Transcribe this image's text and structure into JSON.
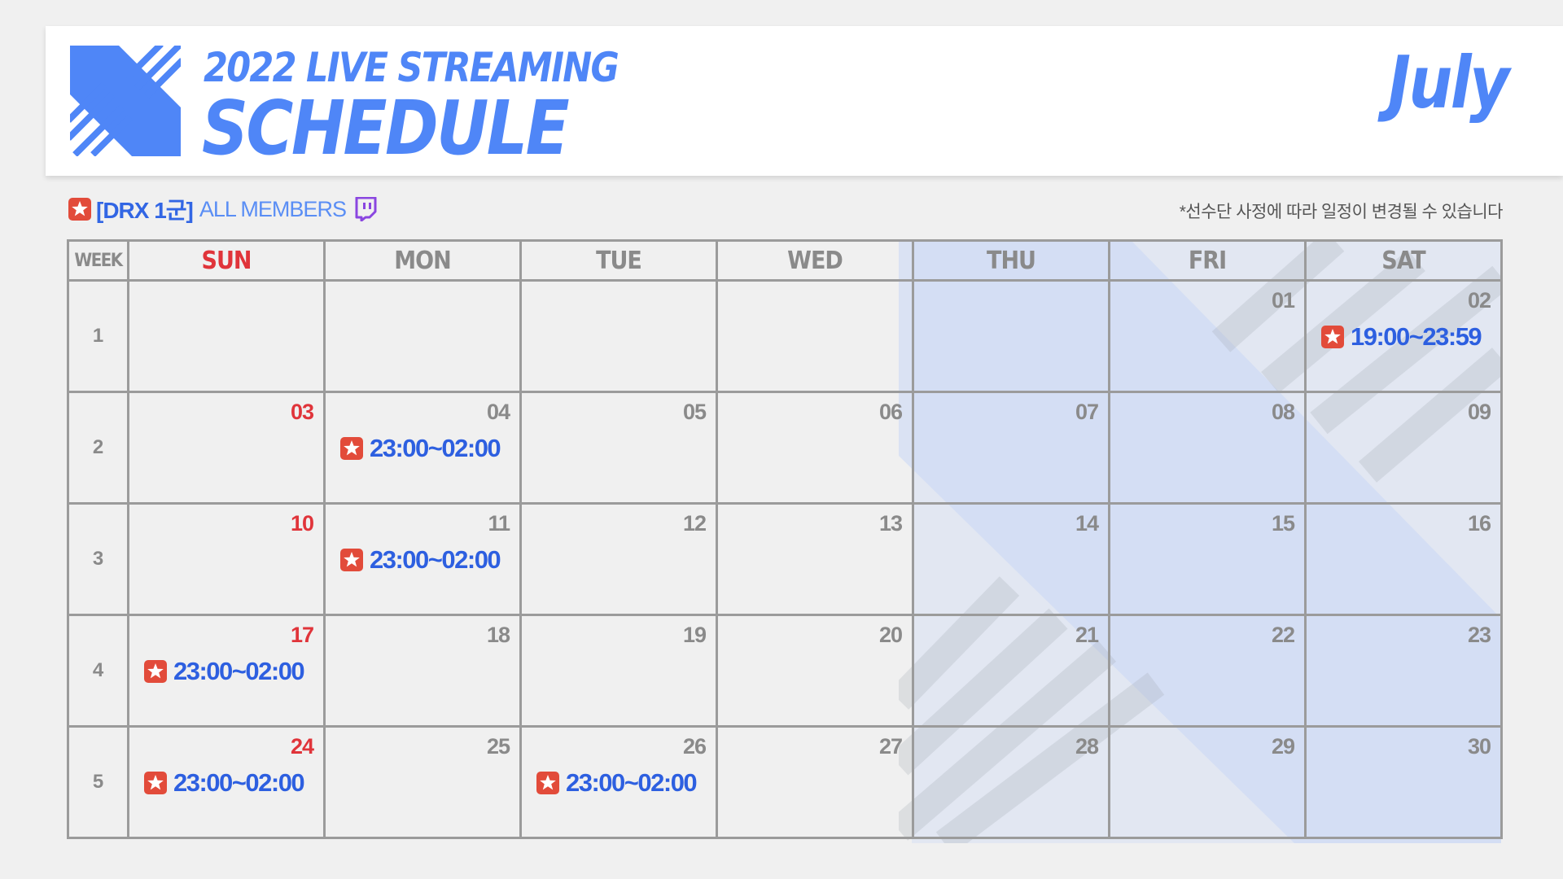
{
  "header": {
    "title_line1": "2022 LIVE STREAMING",
    "title_line2": "SCHEDULE",
    "month": "July"
  },
  "subheader": {
    "team": "[DRX 1군]",
    "members": "ALL MEMBERS",
    "notice": "*선수단 사정에 따라 일정이 변경될 수 있습니다",
    "icons": [
      "star-badge-icon",
      "twitch-icon"
    ]
  },
  "colors": {
    "brand_blue": "#4f86f7",
    "time_blue": "#2d5fe0",
    "sunday_red": "#e0343a",
    "badge_red": "#e24b3a",
    "twitch_purple": "#8a46e0"
  },
  "calendar": {
    "week_header": "WEEK",
    "days": [
      "SUN",
      "MON",
      "TUE",
      "WED",
      "THU",
      "FRI",
      "SAT"
    ],
    "weeks": [
      {
        "week": "1",
        "cells": [
          {
            "day": "",
            "time": ""
          },
          {
            "day": "",
            "time": ""
          },
          {
            "day": "",
            "time": ""
          },
          {
            "day": "",
            "time": ""
          },
          {
            "day": "",
            "time": ""
          },
          {
            "day": "01",
            "time": ""
          },
          {
            "day": "02",
            "time": "19:00~23:59"
          }
        ]
      },
      {
        "week": "2",
        "cells": [
          {
            "day": "03",
            "time": ""
          },
          {
            "day": "04",
            "time": "23:00~02:00"
          },
          {
            "day": "05",
            "time": ""
          },
          {
            "day": "06",
            "time": ""
          },
          {
            "day": "07",
            "time": ""
          },
          {
            "day": "08",
            "time": ""
          },
          {
            "day": "09",
            "time": ""
          }
        ]
      },
      {
        "week": "3",
        "cells": [
          {
            "day": "10",
            "time": ""
          },
          {
            "day": "11",
            "time": "23:00~02:00"
          },
          {
            "day": "12",
            "time": ""
          },
          {
            "day": "13",
            "time": ""
          },
          {
            "day": "14",
            "time": ""
          },
          {
            "day": "15",
            "time": ""
          },
          {
            "day": "16",
            "time": ""
          }
        ]
      },
      {
        "week": "4",
        "cells": [
          {
            "day": "17",
            "time": "23:00~02:00"
          },
          {
            "day": "18",
            "time": ""
          },
          {
            "day": "19",
            "time": ""
          },
          {
            "day": "20",
            "time": ""
          },
          {
            "day": "21",
            "time": ""
          },
          {
            "day": "22",
            "time": ""
          },
          {
            "day": "23",
            "time": ""
          }
        ]
      },
      {
        "week": "5",
        "cells": [
          {
            "day": "24",
            "time": "23:00~02:00"
          },
          {
            "day": "25",
            "time": ""
          },
          {
            "day": "26",
            "time": "23:00~02:00"
          },
          {
            "day": "27",
            "time": ""
          },
          {
            "day": "28",
            "time": ""
          },
          {
            "day": "29",
            "time": ""
          },
          {
            "day": "30",
            "time": ""
          }
        ]
      }
    ]
  }
}
